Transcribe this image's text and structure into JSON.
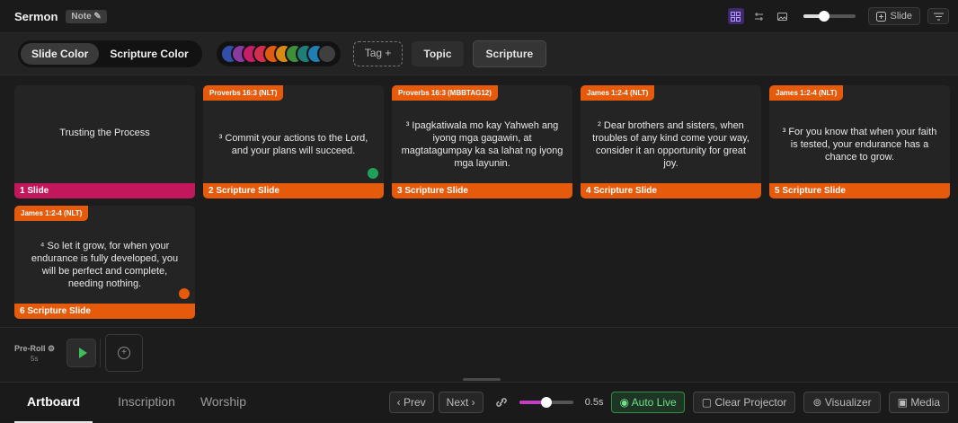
{
  "header": {
    "title": "Sermon",
    "note_badge": "Note ✎",
    "slide_button": "Slide",
    "view_icons": [
      "grid-view-icon",
      "reorder-icon",
      "image-icon"
    ],
    "zoom_level": 0.4
  },
  "toolbar": {
    "color_modes": [
      "Slide Color",
      "Scripture Color"
    ],
    "active_mode": "Slide Color",
    "swatches": [
      "#2f4fa8",
      "#8a3aa0",
      "#c81e6a",
      "#d42e4e",
      "#e05a10",
      "#d88a12",
      "#3f8f3a",
      "#1f7f78",
      "#1f7fb0",
      "#3f3f3f"
    ],
    "tag_label": "Tag +",
    "topic_label": "Topic",
    "scripture_label": "Scripture"
  },
  "slides": [
    {
      "ref": "",
      "text": "Trusting the Process",
      "footer": "1 Slide",
      "color": "#c2185b",
      "dot": ""
    },
    {
      "ref": "Proverbs 16:3 (NLT)",
      "text": "³ Commit your actions to the Lord, and your plans will succeed.",
      "footer": "2 Scripture Slide",
      "color": "#e65a0c",
      "dot": "#1ea05a"
    },
    {
      "ref": "Proverbs 16:3 (MBBTAG12)",
      "text": "³ Ipagkatiwala mo kay Yahweh ang iyong mga gagawin, at magtatagumpay ka sa lahat ng iyong mga layunin.",
      "footer": "3 Scripture Slide",
      "color": "#e65a0c",
      "dot": ""
    },
    {
      "ref": "James 1:2-4 (NLT)",
      "text": "² Dear brothers and sisters, when troubles of any kind come your way, consider it an opportunity for great joy.",
      "footer": "4 Scripture Slide",
      "color": "#e65a0c",
      "dot": ""
    },
    {
      "ref": "James 1:2-4 (NLT)",
      "text": "³ For you know that when your faith is tested, your endurance has a chance to grow.",
      "footer": "5 Scripture Slide",
      "color": "#e65a0c",
      "dot": ""
    },
    {
      "ref": "James 1:2-4 (NLT)",
      "text": "⁴ So let it grow, for when your endurance is fully developed, you will be perfect and complete, needing nothing.",
      "footer": "6 Scripture Slide",
      "color": "#e65a0c",
      "dot": "#e65a0c"
    }
  ],
  "preroll": {
    "label": "Pre-Roll ⚙",
    "time": "5s"
  },
  "bottom": {
    "tabs": [
      "Artboard",
      "Inscription",
      "Worship"
    ],
    "prev": "‹ Prev",
    "next": "Next ›",
    "speed": "0.5s",
    "speed_level": 0.5,
    "autolive": "Auto Live",
    "clear": "Clear Projector",
    "visualizer": "Visualizer",
    "media": "Media"
  }
}
